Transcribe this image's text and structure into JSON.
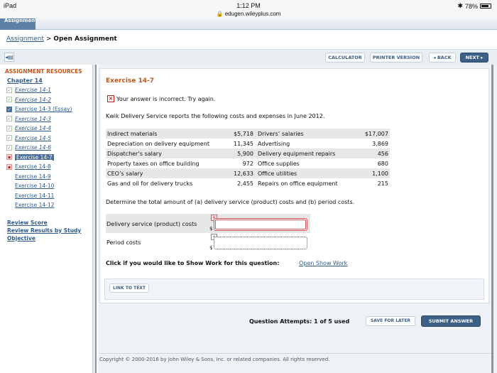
{
  "status_bar": {
    "device": "iPad",
    "time": "1:12 PM",
    "url": "edugen.wileyplus.com",
    "battery": "78%"
  },
  "top_tab": "Assignment",
  "breadcrumb": {
    "parent": "Assignment",
    "separator": ">",
    "current": "Open Assignment"
  },
  "toolbar": {
    "calculator": "CALCULATOR",
    "printer_version": "PRINTER VERSION",
    "back": "◂ BACK",
    "next": "NEXT ▸"
  },
  "sidebar": {
    "heading": "ASSIGNMENT RESOURCES",
    "chapter": "Chapter 14",
    "items": [
      {
        "label": "Exercise 14-1",
        "status": "done"
      },
      {
        "label": "Exercise 14-2",
        "status": "done"
      },
      {
        "label": "Exercise 14-3 (Essay)",
        "status": "essay"
      },
      {
        "label": "Exercise 14-3",
        "status": "done"
      },
      {
        "label": "Exercise 14-4",
        "status": "done"
      },
      {
        "label": "Exercise 14-5",
        "status": "done"
      },
      {
        "label": "Exercise 14-6",
        "status": "done"
      },
      {
        "label": "Exercise 14-7",
        "status": "wrong",
        "active": true
      },
      {
        "label": "Exercise 14-8",
        "status": "wrong"
      },
      {
        "label": "Exercise 14-9",
        "status": "none"
      },
      {
        "label": "Exercise 14-10",
        "status": "none"
      },
      {
        "label": "Exercise 14-11",
        "status": "none"
      },
      {
        "label": "Exercise 14-12",
        "status": "none"
      }
    ],
    "links": {
      "review_score": "Review Score",
      "review_results": "Review Results by Study Objective"
    }
  },
  "exercise": {
    "title": "Exercise 14-7",
    "feedback": "Your answer is incorrect.  Try again.",
    "intro": "Kwik Delivery Service reports the following costs and expenses in June 2012.",
    "costs": [
      {
        "left_label": "Indirect materials",
        "left_value": "$5,718",
        "right_label": "Drivers’ salaries",
        "right_value": "$17,007"
      },
      {
        "left_label": "Depreciation on delivery equipment",
        "left_value": "11,345",
        "right_label": "Advertising",
        "right_value": "3,869"
      },
      {
        "left_label": "Dispatcher’s salary",
        "left_value": "5,900",
        "right_label": "Delivery equipment repairs",
        "right_value": "456"
      },
      {
        "left_label": "Property taxes on office building",
        "left_value": "972",
        "right_label": "Office supplies",
        "right_value": "680"
      },
      {
        "left_label": "CEO’s salary",
        "left_value": "12,633",
        "right_label": "Office utilities",
        "right_value": "1,100"
      },
      {
        "left_label": "Gas and oil for delivery trucks",
        "left_value": "2,455",
        "right_label": "Repairs on office equipment",
        "right_value": "215"
      }
    ],
    "question": "Determine the total amount of (a) delivery service (product) costs and (b) period costs.",
    "answers": [
      {
        "label": "Delivery service (product) costs",
        "currency": "$",
        "value": "",
        "state": "incorrect"
      },
      {
        "label": "Period costs",
        "currency": "$",
        "value": "",
        "state": "unanswered"
      }
    ],
    "show_work_prompt": "Click if you would like to Show Work for this question:",
    "show_work_link": "Open Show Work",
    "link_to_text": "LINK TO TEXT"
  },
  "footer": {
    "attempts": "Question Attempts: 1 of 5 used",
    "save_for_later": "SAVE FOR LATER",
    "submit_answer": "SUBMIT ANSWER",
    "copyright": "Copyright © 2000-2016 by John Wiley & Sons, Inc. or related companies. All rights reserved."
  }
}
